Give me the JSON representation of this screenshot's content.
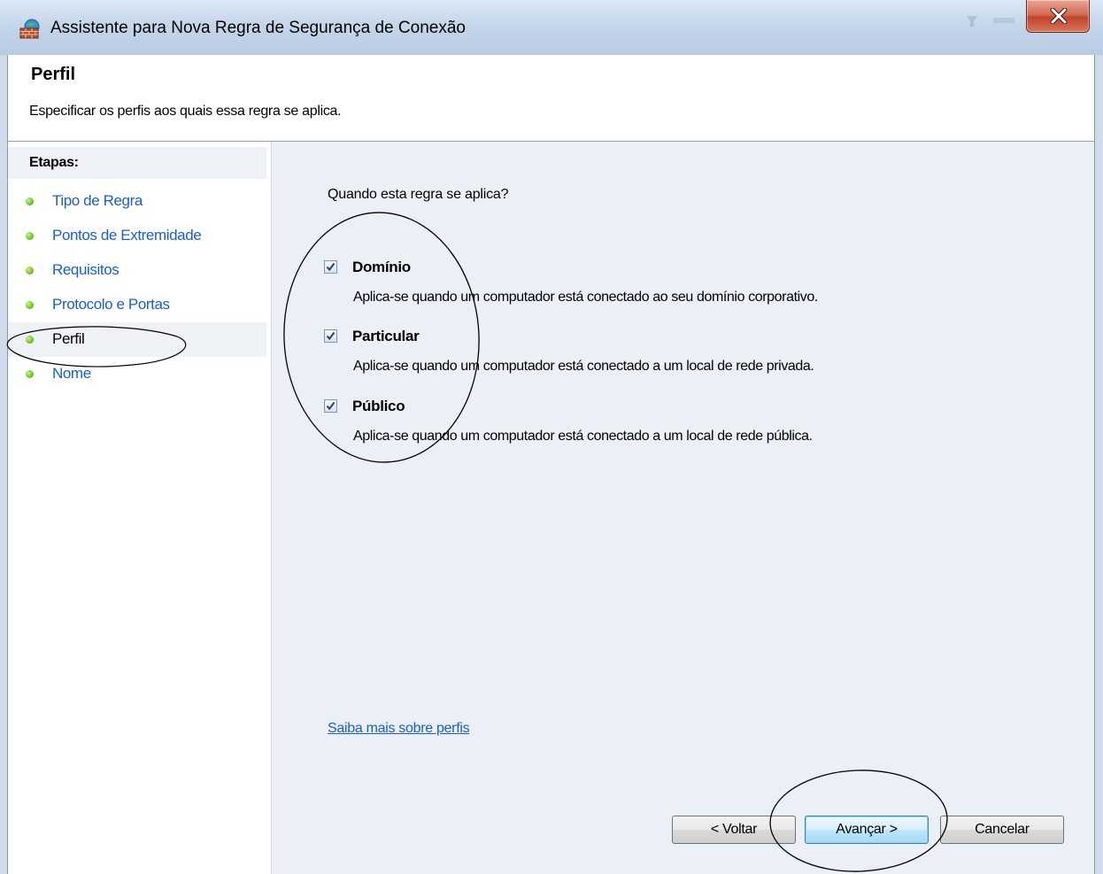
{
  "window": {
    "title": "Assistente para Nova Regra de Segurança de Conexão",
    "icon": "firewall-wall-globe-icon",
    "close_icon": "close-x-icon"
  },
  "header": {
    "title": "Perfil",
    "subtitle": "Especificar os perfis aos quais essa regra se aplica."
  },
  "sidebar": {
    "heading": "Etapas:",
    "current_index": 4,
    "items": [
      {
        "label": "Tipo de Regra"
      },
      {
        "label": "Pontos de Extremidade"
      },
      {
        "label": "Requisitos"
      },
      {
        "label": "Protocolo e Portas"
      },
      {
        "label": "Perfil"
      },
      {
        "label": "Nome"
      }
    ]
  },
  "main": {
    "question": "Quando esta regra se aplica?",
    "options": [
      {
        "label": "Domínio",
        "checked": true,
        "description": "Aplica-se quando um computador está conectado ao seu domínio corporativo."
      },
      {
        "label": "Particular",
        "checked": true,
        "description": "Aplica-se quando um computador está conectado a um local de rede privada."
      },
      {
        "label": "Público",
        "checked": true,
        "description": "Aplica-se quando um computador está conectado a um local de rede pública."
      }
    ],
    "learn_more": "Saiba mais sobre perfis"
  },
  "buttons": {
    "back": "< Voltar",
    "next": "Avançar >",
    "cancel": "Cancelar"
  },
  "colors": {
    "link": "#1a5ec8",
    "panel_background": "#ebf0f6",
    "step_bullet": "#7ac82e",
    "close_button": "#c0442a"
  }
}
